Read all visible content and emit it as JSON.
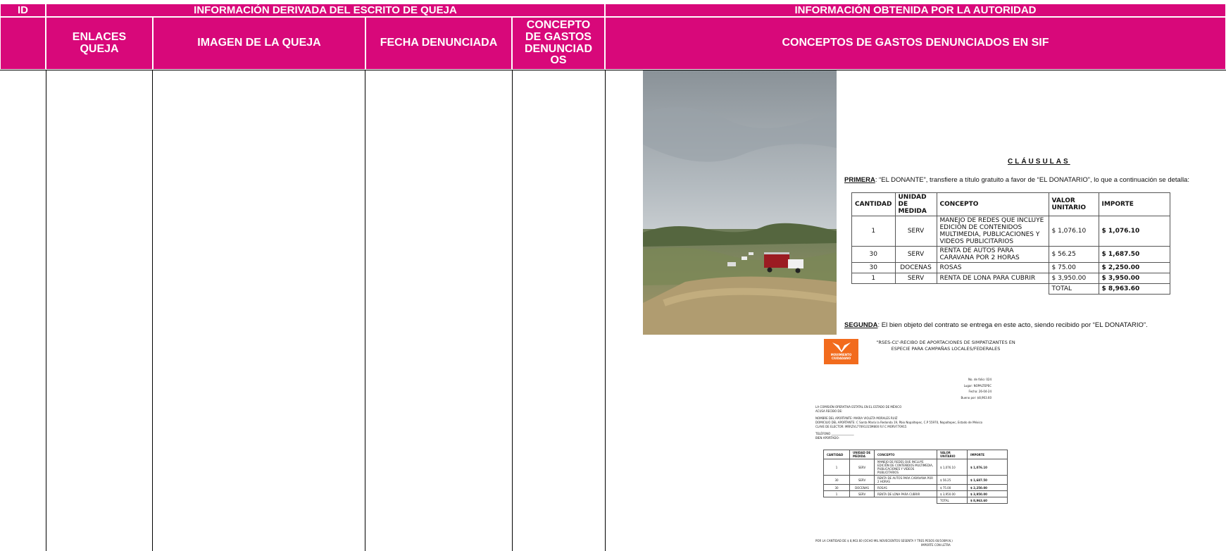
{
  "headers": {
    "id": "ID",
    "info_queja": "INFORMACIÓN DERIVADA DEL ESCRITO DE QUEJA",
    "info_autoridad": "INFORMACIÓN OBTENIDA POR LA AUTORIDAD",
    "enlaces_queja": "ENLACES QUEJA",
    "imagen_queja": "IMAGEN DE LA QUEJA",
    "fecha_denunciada": "FECHA DENUNCIADA",
    "concepto_gastos": "CONCEPTO DE GASTOS DENUNCIAD OS",
    "conceptos_sif": "CONCEPTOS DE GASTOS DENUNCIADOS EN SIF"
  },
  "colors": {
    "header_bg": "#d8087a",
    "header_text": "#ffffff",
    "logo_orange": "#f26b1d"
  },
  "contract": {
    "clausulas_title": "CLÁUSULAS",
    "primera_label": "PRIMERA",
    "primera_text_1": ": “EL DONANTE”, transfiere a título gratuito a favor de “EL DONATARIO”, lo que a continuación se detalla:",
    "table_headers": [
      "CANTIDAD",
      "UNIDAD DE MEDIDA",
      "CONCEPTO",
      "VALOR UNITARIO",
      "IMPORTE"
    ],
    "rows": [
      {
        "cantidad": "1",
        "unidad": "SERV",
        "concepto": "MANEJO DE REDES QUE INCLUYE EDICIÓN DE CONTENIDOS MULTIMEDIA, PUBLICACIONES Y VIDEOS PUBLICITARIOS",
        "valor": "$ 1,076.10",
        "importe": "$ 1,076.10"
      },
      {
        "cantidad": "30",
        "unidad": "SERV",
        "concepto": "RENTA DE AUTOS PARA CARAVANA POR 2 HORAS",
        "valor": "$ 56.25",
        "importe": "$ 1,687.50"
      },
      {
        "cantidad": "30",
        "unidad": "DOCENAS",
        "concepto": "ROSAS",
        "valor": "$ 75.00",
        "importe": "$ 2,250.00"
      },
      {
        "cantidad": "1",
        "unidad": "SERV",
        "concepto": "RENTA DE LONA PARA CUBRIR",
        "valor": "$ 3,950.00",
        "importe": "$ 3,950.00"
      }
    ],
    "total_label": "TOTAL",
    "total_value": "$ 8,963.60",
    "segunda_label": "SEGUNDA",
    "segunda_text": ": El bien objeto del contrato se entrega en este acto, siendo recibido por “EL DONATARIO”."
  },
  "receipt": {
    "logo_text": "MOVIMIENTO CIUDADANO",
    "title": "“RSES-CL”-RECIBO DE APORTACIONES DE SIMPATIZANTES EN ESPECIE PARA CAMPAÑAS LOCALES/FEDERALES",
    "folio": "No. de folio: 024",
    "lugar": "Lugar: NOPALTEPEC",
    "fecha": "Fecha: 26-04-24",
    "bueno_por": "Bueno por: $8,963.60",
    "comision": "LA COMISIÓN OPERATIVA ESTATAL EN EL ESTADO DE MÉXICO",
    "acusa": "ACUSA RECIBO DE:",
    "nombre": "NOMBRE DEL APORTANTE: MARIA VIOLETA MORALES RUIZ",
    "domicilio": "DOMICILIO DEL APORTANTE: C Santa María la Redonda 19, Pbio Nopaltepec, C.P 55970, Nopaltepec, Estado de México",
    "clave": "CLAVE DE ELECTOR: MRRZVL77091315M800            R.F.C MORV770915",
    "telefono": "TELÉFONO ________________",
    "bien": "BIEN APORTADO:",
    "cantidad_de": "POR LA CANTIDAD DE $ 8,963.60          (OCHO MIL NOVECIENTOS SESENTA Y TRES PESOS 60/100M.N.)",
    "importe_letra": "IMPORTE CON LETRA"
  }
}
